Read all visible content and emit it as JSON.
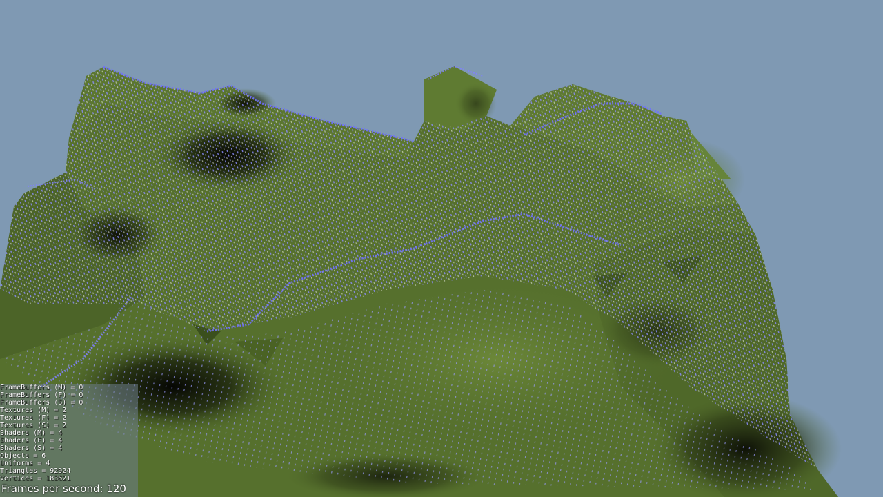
{
  "scene": {
    "background_color": "#7f99b3",
    "terrain_color": "#56702d",
    "terrain_shadow_color": "#0b0d05",
    "wireframe_point_color": "#7c7cff",
    "render_mode": "shaded terrain with point-sampled wireframe overlay"
  },
  "stats": {
    "lines": [
      "FrameBuffers (M) = 0",
      "FrameBuffers (F) = 0",
      "FrameBuffers (S) = 0",
      "Textures (M) = 2",
      "Textures (F) = 2",
      "Textures (S) = 2",
      "Shaders (M) = 4",
      "Shaders (F) = 4",
      "Shaders (S) = 4",
      "Objects = 6",
      "Uniforms = 4",
      "Triangles = 92924",
      "Vertices = 183621"
    ],
    "fps_label": "Frames per second: 120"
  }
}
